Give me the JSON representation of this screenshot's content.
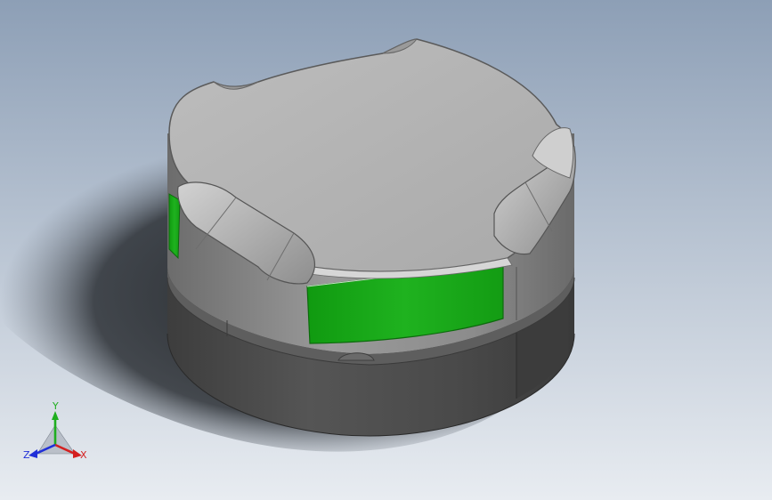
{
  "viewport": {
    "background_top": "#8d9fb6",
    "background_bottom": "#e8ecf1"
  },
  "model": {
    "body_color": "#4a4a4a",
    "collar_color": "#8a8a8a",
    "cap_color": "#b4b4b4",
    "window_color": "#1ea81e"
  },
  "triad": {
    "y_label": "Y",
    "x_label": "X",
    "z_label": "Z",
    "y_color": "#1fae1f",
    "x_color": "#d42020",
    "z_color": "#2030d8"
  }
}
